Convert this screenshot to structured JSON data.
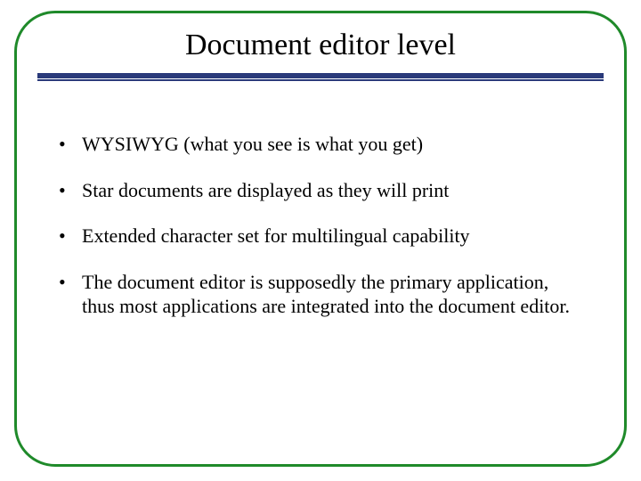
{
  "title": "Document editor level",
  "bullets": [
    "WYSIWYG (what you see is what you get)",
    "Star documents are displayed as they will print",
    "Extended character set for multilingual capability",
    "The document editor is supposedly the primary application, thus most applications are integrated into the document editor."
  ]
}
